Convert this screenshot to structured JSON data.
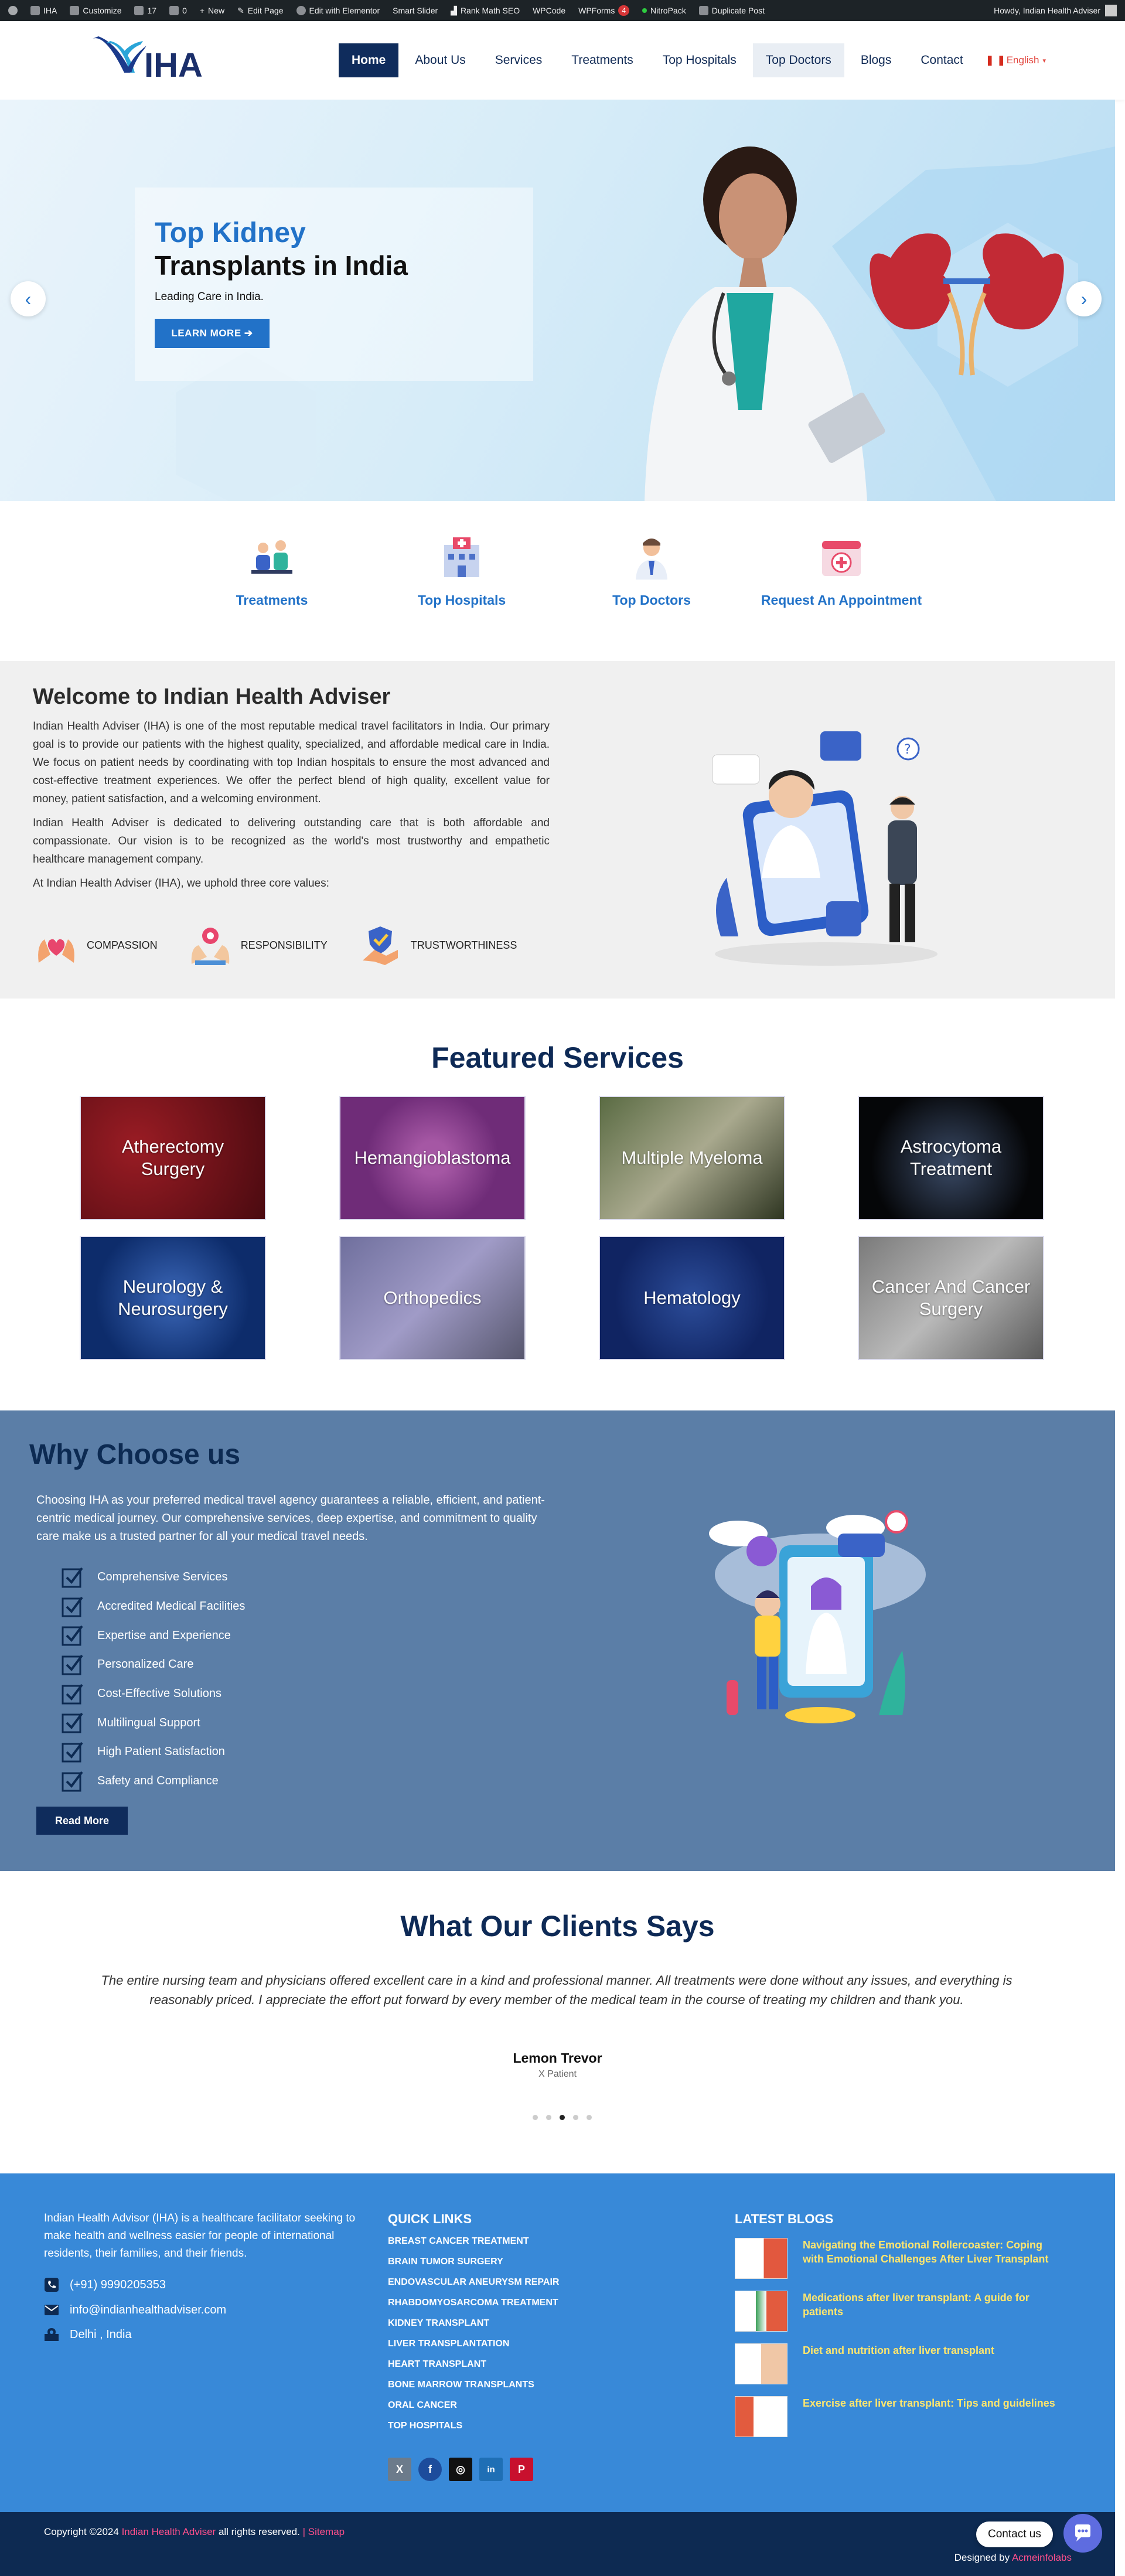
{
  "adminbar": {
    "site": "IHA",
    "customize": "Customize",
    "updates": "17",
    "comments": "0",
    "new": "New",
    "edit_page": "Edit Page",
    "elementor": "Edit with Elementor",
    "smart_slider": "Smart Slider",
    "rank_math": "Rank Math SEO",
    "wpcode": "WPCode",
    "wpforms": "WPForms",
    "wpforms_count": "4",
    "nitropack": "NitroPack",
    "duplicate": "Duplicate Post",
    "howdy": "Howdy, Indian Health Adviser"
  },
  "header": {
    "logo_text": "IHA",
    "nav": [
      "Home",
      "About Us",
      "Services",
      "Treatments",
      "Top Hospitals",
      "Top Doctors",
      "Blogs",
      "Contact"
    ],
    "language": "English"
  },
  "hero": {
    "title_line1": "Top Kidney",
    "title_line2": "Transplants in India",
    "subtitle": "Leading Care in India.",
    "button": "LEARN MORE ➔",
    "prev": "‹",
    "next": "›"
  },
  "quicklinks": [
    "Treatments",
    "Top Hospitals",
    "Top Doctors",
    "Request An Appointment"
  ],
  "welcome": {
    "title": "Welcome to Indian Health Adviser",
    "p1": "Indian Health Adviser (IHA) is one of the most reputable medical travel facilitators in India. Our primary goal is to provide our patients with the highest quality, specialized, and affordable medical care in India. We focus on patient needs by coordinating with top Indian hospitals to ensure the most advanced and cost-effective treatment experiences. We offer the perfect blend of high quality, excellent value for money, patient satisfaction, and a welcoming environment.",
    "p2": "Indian Health Adviser is dedicated to delivering outstanding care that is both affordable and compassionate. Our vision is to be recognized as the world's most trustworthy and empathetic healthcare management company.",
    "p3": "At Indian Health Adviser (IHA), we uphold three core values:",
    "values": [
      "COMPASSION",
      "RESPONSIBILITY",
      "TRUSTWORTHINESS"
    ]
  },
  "featured": {
    "title": "Featured Services",
    "cards": [
      "Atherectomy Surgery",
      "Hemangioblastoma",
      "Multiple Myeloma",
      "Astrocytoma Treatment",
      "Neurology & Neurosurgery",
      "Orthopedics",
      "Hematology",
      "Cancer And Cancer Surgery"
    ]
  },
  "why": {
    "title": "Why Choose us",
    "intro": "Choosing IHA as your preferred medical travel agency guarantees a reliable, efficient, and patient-centric medical journey. Our comprehensive services, deep expertise, and commitment to quality care make us a trusted partner for all your medical travel needs.",
    "items": [
      "Comprehensive Services",
      "Accredited Medical Facilities",
      "Expertise and Experience",
      "Personalized Care",
      "Cost-Effective Solutions",
      "Multilingual Support",
      "High Patient Satisfaction",
      "Safety and Compliance"
    ],
    "button": "Read More"
  },
  "testimonials": {
    "title": "What Our Clients Says",
    "quote": "The entire nursing team and physicians offered excellent care in a kind and professional manner. All treatments were done without any issues, and everything is reasonably priced. I appreciate the effort put forward by every member of the medical team in the course of treating my children and thank you.",
    "name": "Lemon Trevor",
    "role": "X Patient",
    "active_slide": 3,
    "slide_count": 5
  },
  "footer": {
    "about": "Indian Health Advisor (IHA) is a healthcare facilitator seeking to make health and wellness easier for people of international residents, their families, and their friends.",
    "phone": "(+91) 9990205353",
    "email": "info@indianhealthadviser.com",
    "address": "Delhi , India",
    "quick_links_title": "QUICK LINKS",
    "quick_links": [
      "BREAST CANCER TREATMENT",
      "BRAIN TUMOR SURGERY",
      "ENDOVASCULAR ANEURYSM REPAIR",
      "RHABDOMYOSARCOMA TREATMENT",
      "KIDNEY TRANSPLANT",
      "LIVER TRANSPLANTATION",
      "HEART TRANSPLANT",
      "BONE MARROW TRANSPLANTS",
      "ORAL CANCER",
      "TOP HOSPITALS"
    ],
    "social": [
      "X",
      "f",
      "◎",
      "in",
      "P"
    ],
    "blogs_title": "LATEST BLOGS",
    "blogs": [
      "Navigating the Emotional Rollercoaster: Coping with Emotional Challenges After Liver Transplant",
      "Medications after liver transplant: A guide for patients",
      "Diet and nutrition after liver transplant",
      "Exercise after liver transplant: Tips and guidelines"
    ]
  },
  "bottom": {
    "copy_pre": "Copyright ©2024",
    "brand": "Indian Health Adviser",
    "copy_post": "all rights reserved.",
    "sep": "|",
    "sitemap": "Sitemap",
    "designed_by": "Designed by",
    "designer": "Acmeinfolabs"
  },
  "chat": {
    "label": "Contact us"
  },
  "colors": {
    "primary": "#0f2c5c",
    "accent": "#2272c8",
    "why_bg": "#5b7ea7",
    "footer_bg": "#3889d8",
    "bottom_bg": "#0d2a52",
    "blog_link": "#ffe66d",
    "pink": "#ff4f8b"
  }
}
